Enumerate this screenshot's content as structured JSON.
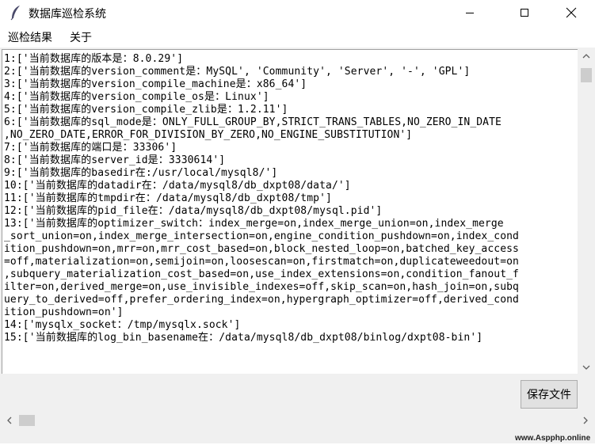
{
  "window": {
    "title": "数据库巡检系统",
    "icon": "feather-icon"
  },
  "menu": {
    "items": [
      "巡检结果",
      "关于"
    ]
  },
  "output": {
    "lines": [
      "1:['当前数据库的版本是：8.0.29']",
      "2:['当前数据库的version_comment是：MySQL', 'Community', 'Server', '-', 'GPL']",
      "3:['当前数据库的version_compile_machine是：x86_64']",
      "4:['当前数据库的version_compile_os是：Linux']",
      "5:['当前数据库的version_compile_zlib是：1.2.11']",
      "6:['当前数据库的sql_mode是：ONLY_FULL_GROUP_BY,STRICT_TRANS_TABLES,NO_ZERO_IN_DATE",
      ",NO_ZERO_DATE,ERROR_FOR_DIVISION_BY_ZERO,NO_ENGINE_SUBSTITUTION']",
      "7:['当前数据库的端口是：33306']",
      "8:['当前数据库的server_id是：3330614']",
      "9:['当前数据库的basedir在:/usr/local/mysql8/']",
      "10:['当前数据库的datadir在：/data/mysql8/db_dxpt08/data/']",
      "11:['当前数据库的tmpdir在：/data/mysql8/db_dxpt08/tmp']",
      "12:['当前数据库的pid_file在：/data/mysql8/db_dxpt08/mysql.pid']",
      "13:['当前数据库的optimizer_switch：index_merge=on,index_merge_union=on,index_merge",
      "_sort_union=on,index_merge_intersection=on,engine_condition_pushdown=on,index_cond",
      "ition_pushdown=on,mrr=on,mrr_cost_based=on,block_nested_loop=on,batched_key_access",
      "=off,materialization=on,semijoin=on,loosescan=on,firstmatch=on,duplicateweedout=on",
      ",subquery_materialization_cost_based=on,use_index_extensions=on,condition_fanout_f",
      "ilter=on,derived_merge=on,use_invisible_indexes=off,skip_scan=on,hash_join=on,subq",
      "uery_to_derived=off,prefer_ordering_index=on,hypergraph_optimizer=off,derived_cond",
      "ition_pushdown=on']",
      "14:['mysqlx_socket：/tmp/mysqlx.sock']",
      "15:['当前数据库的log_bin_basename在：/data/mysql8/db_dxpt08/binlog/dxpt08-bin']"
    ]
  },
  "buttons": {
    "save": "保存文件"
  },
  "watermark": "www.Aspphp.online"
}
